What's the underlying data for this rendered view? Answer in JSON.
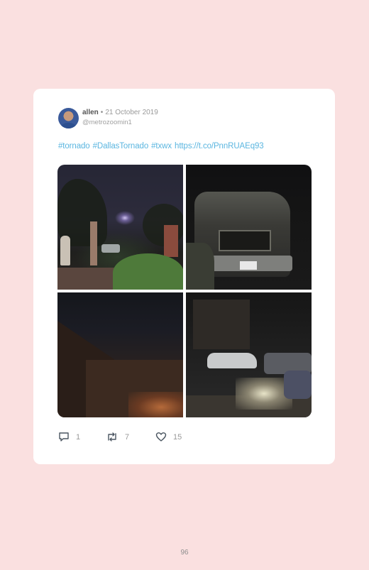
{
  "tweet": {
    "name": "allen",
    "separator": "•",
    "date": "21 October 2019",
    "handle": "@metrozoomin1",
    "text_parts": [
      "#tornado",
      "#DallasTornado",
      "#txwx",
      "https://t.co/PnnRUAEq93"
    ],
    "images": [
      "tornado-damage-photo-1",
      "tornado-damage-photo-2",
      "tornado-damage-photo-3",
      "tornado-damage-photo-4"
    ],
    "replies": "1",
    "retweets": "7",
    "likes": "15"
  },
  "page_number": "96",
  "colors": {
    "background": "#fae0e0",
    "card": "#ffffff",
    "link": "#5bb6e0"
  }
}
